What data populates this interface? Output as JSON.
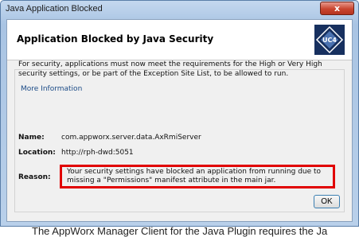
{
  "window": {
    "title": "Java Application Blocked",
    "close_label": "x"
  },
  "dialog": {
    "header_title": "Application Blocked by Java Security",
    "logo_text": "UC4",
    "message": "For security, applications must now meet the requirements for the High or Very High security settings, or be part of the Exception Site List, to be allowed to run.",
    "more_info_link": "More Information",
    "name_label": "Name:",
    "name_value": "com.appworx.server.data.AxRmiServer",
    "location_label": "Location:",
    "location_value": "http://rph-dwd:5051",
    "reason_label": "Reason:",
    "reason_value": "Your security settings have blocked an application from running due to missing a \"Permissions\" manifest attribute in the main jar.",
    "ok_label": "OK"
  },
  "background": {
    "text": "The AppWorx Manager Client for the Java Plugin requires the Ja"
  },
  "colors": {
    "highlight_border": "#e10000",
    "logo_bg": "#17305f",
    "link": "#1a4a86"
  }
}
